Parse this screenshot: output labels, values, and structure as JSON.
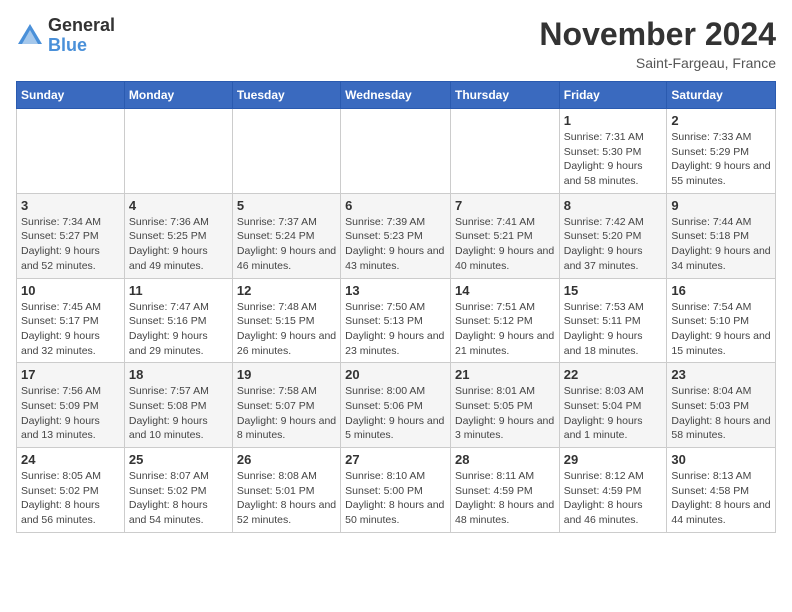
{
  "header": {
    "logo_line1": "General",
    "logo_line2": "Blue",
    "month_title": "November 2024",
    "location": "Saint-Fargeau, France"
  },
  "days_of_week": [
    "Sunday",
    "Monday",
    "Tuesday",
    "Wednesday",
    "Thursday",
    "Friday",
    "Saturday"
  ],
  "weeks": [
    [
      {
        "day": "",
        "info": ""
      },
      {
        "day": "",
        "info": ""
      },
      {
        "day": "",
        "info": ""
      },
      {
        "day": "",
        "info": ""
      },
      {
        "day": "",
        "info": ""
      },
      {
        "day": "1",
        "info": "Sunrise: 7:31 AM\nSunset: 5:30 PM\nDaylight: 9 hours and 58 minutes."
      },
      {
        "day": "2",
        "info": "Sunrise: 7:33 AM\nSunset: 5:29 PM\nDaylight: 9 hours and 55 minutes."
      }
    ],
    [
      {
        "day": "3",
        "info": "Sunrise: 7:34 AM\nSunset: 5:27 PM\nDaylight: 9 hours and 52 minutes."
      },
      {
        "day": "4",
        "info": "Sunrise: 7:36 AM\nSunset: 5:25 PM\nDaylight: 9 hours and 49 minutes."
      },
      {
        "day": "5",
        "info": "Sunrise: 7:37 AM\nSunset: 5:24 PM\nDaylight: 9 hours and 46 minutes."
      },
      {
        "day": "6",
        "info": "Sunrise: 7:39 AM\nSunset: 5:23 PM\nDaylight: 9 hours and 43 minutes."
      },
      {
        "day": "7",
        "info": "Sunrise: 7:41 AM\nSunset: 5:21 PM\nDaylight: 9 hours and 40 minutes."
      },
      {
        "day": "8",
        "info": "Sunrise: 7:42 AM\nSunset: 5:20 PM\nDaylight: 9 hours and 37 minutes."
      },
      {
        "day": "9",
        "info": "Sunrise: 7:44 AM\nSunset: 5:18 PM\nDaylight: 9 hours and 34 minutes."
      }
    ],
    [
      {
        "day": "10",
        "info": "Sunrise: 7:45 AM\nSunset: 5:17 PM\nDaylight: 9 hours and 32 minutes."
      },
      {
        "day": "11",
        "info": "Sunrise: 7:47 AM\nSunset: 5:16 PM\nDaylight: 9 hours and 29 minutes."
      },
      {
        "day": "12",
        "info": "Sunrise: 7:48 AM\nSunset: 5:15 PM\nDaylight: 9 hours and 26 minutes."
      },
      {
        "day": "13",
        "info": "Sunrise: 7:50 AM\nSunset: 5:13 PM\nDaylight: 9 hours and 23 minutes."
      },
      {
        "day": "14",
        "info": "Sunrise: 7:51 AM\nSunset: 5:12 PM\nDaylight: 9 hours and 21 minutes."
      },
      {
        "day": "15",
        "info": "Sunrise: 7:53 AM\nSunset: 5:11 PM\nDaylight: 9 hours and 18 minutes."
      },
      {
        "day": "16",
        "info": "Sunrise: 7:54 AM\nSunset: 5:10 PM\nDaylight: 9 hours and 15 minutes."
      }
    ],
    [
      {
        "day": "17",
        "info": "Sunrise: 7:56 AM\nSunset: 5:09 PM\nDaylight: 9 hours and 13 minutes."
      },
      {
        "day": "18",
        "info": "Sunrise: 7:57 AM\nSunset: 5:08 PM\nDaylight: 9 hours and 10 minutes."
      },
      {
        "day": "19",
        "info": "Sunrise: 7:58 AM\nSunset: 5:07 PM\nDaylight: 9 hours and 8 minutes."
      },
      {
        "day": "20",
        "info": "Sunrise: 8:00 AM\nSunset: 5:06 PM\nDaylight: 9 hours and 5 minutes."
      },
      {
        "day": "21",
        "info": "Sunrise: 8:01 AM\nSunset: 5:05 PM\nDaylight: 9 hours and 3 minutes."
      },
      {
        "day": "22",
        "info": "Sunrise: 8:03 AM\nSunset: 5:04 PM\nDaylight: 9 hours and 1 minute."
      },
      {
        "day": "23",
        "info": "Sunrise: 8:04 AM\nSunset: 5:03 PM\nDaylight: 8 hours and 58 minutes."
      }
    ],
    [
      {
        "day": "24",
        "info": "Sunrise: 8:05 AM\nSunset: 5:02 PM\nDaylight: 8 hours and 56 minutes."
      },
      {
        "day": "25",
        "info": "Sunrise: 8:07 AM\nSunset: 5:02 PM\nDaylight: 8 hours and 54 minutes."
      },
      {
        "day": "26",
        "info": "Sunrise: 8:08 AM\nSunset: 5:01 PM\nDaylight: 8 hours and 52 minutes."
      },
      {
        "day": "27",
        "info": "Sunrise: 8:10 AM\nSunset: 5:00 PM\nDaylight: 8 hours and 50 minutes."
      },
      {
        "day": "28",
        "info": "Sunrise: 8:11 AM\nSunset: 4:59 PM\nDaylight: 8 hours and 48 minutes."
      },
      {
        "day": "29",
        "info": "Sunrise: 8:12 AM\nSunset: 4:59 PM\nDaylight: 8 hours and 46 minutes."
      },
      {
        "day": "30",
        "info": "Sunrise: 8:13 AM\nSunset: 4:58 PM\nDaylight: 8 hours and 44 minutes."
      }
    ]
  ]
}
